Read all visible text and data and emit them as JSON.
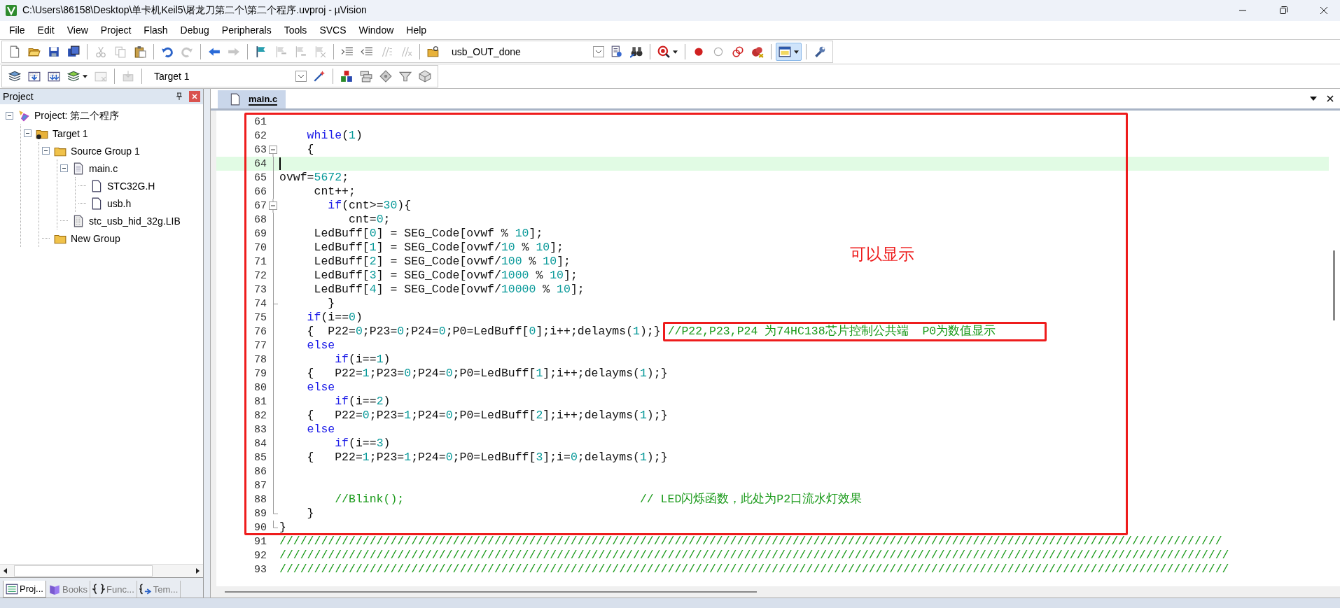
{
  "window": {
    "title": "C:\\Users\\86158\\Desktop\\单卡机Keil5\\屠龙刀第二个\\第二个程序.uvproj - µVision"
  },
  "menu": [
    "File",
    "Edit",
    "View",
    "Project",
    "Flash",
    "Debug",
    "Peripherals",
    "Tools",
    "SVCS",
    "Window",
    "Help"
  ],
  "toolbar_1": [
    {
      "kind": "new-file",
      "disabled": false,
      "pressed": false
    },
    {
      "kind": "open-folder",
      "disabled": false,
      "pressed": false
    },
    {
      "kind": "save",
      "disabled": false,
      "pressed": false
    },
    {
      "kind": "save-all",
      "disabled": false,
      "pressed": false
    },
    {
      "kind": "sep"
    },
    {
      "kind": "scissors",
      "disabled": true,
      "pressed": false
    },
    {
      "kind": "copy",
      "disabled": true,
      "pressed": false
    },
    {
      "kind": "paste",
      "disabled": false,
      "pressed": false
    },
    {
      "kind": "sep"
    },
    {
      "kind": "undo",
      "disabled": false,
      "pressed": false
    },
    {
      "kind": "redo",
      "disabled": true,
      "pressed": false
    },
    {
      "kind": "sep"
    },
    {
      "kind": "arrow-left",
      "disabled": false,
      "pressed": false
    },
    {
      "kind": "arrow-right",
      "disabled": true,
      "pressed": false
    },
    {
      "kind": "sep"
    },
    {
      "kind": "flag",
      "disabled": false,
      "pressed": false
    },
    {
      "kind": "flag-prev",
      "disabled": true,
      "pressed": false
    },
    {
      "kind": "flag-next",
      "disabled": true,
      "pressed": false
    },
    {
      "kind": "flag-clear",
      "disabled": true,
      "pressed": false
    },
    {
      "kind": "sep"
    },
    {
      "kind": "indent",
      "disabled": false,
      "pressed": false
    },
    {
      "kind": "unindent",
      "disabled": false,
      "pressed": false
    },
    {
      "kind": "comment",
      "disabled": true,
      "pressed": false
    },
    {
      "kind": "uncomment",
      "disabled": true,
      "pressed": false
    },
    {
      "kind": "sep"
    },
    {
      "kind": "folder-search",
      "disabled": false,
      "pressed": false
    },
    {
      "kind": "dropdown",
      "value": "usb_OUT_done"
    },
    {
      "kind": "document-search",
      "disabled": false,
      "pressed": false
    },
    {
      "kind": "binoculars",
      "disabled": false,
      "pressed": false
    },
    {
      "kind": "sep"
    },
    {
      "kind": "debug-magnifier",
      "disabled": false,
      "pressed": false,
      "menu": true
    },
    {
      "kind": "sep"
    },
    {
      "kind": "red-dot",
      "disabled": false,
      "pressed": false
    },
    {
      "kind": "empty-circle",
      "disabled": false,
      "pressed": false
    },
    {
      "kind": "red-rings",
      "disabled": false,
      "pressed": false
    },
    {
      "kind": "red-dot-cross",
      "disabled": false,
      "pressed": false
    },
    {
      "kind": "sep"
    },
    {
      "kind": "window-layout",
      "disabled": false,
      "pressed": true,
      "menu": true
    },
    {
      "kind": "sep"
    },
    {
      "kind": "wrench",
      "disabled": false,
      "pressed": false
    }
  ],
  "toolbar_2": [
    {
      "kind": "stack",
      "disabled": false,
      "pressed": false
    },
    {
      "kind": "build",
      "disabled": false,
      "pressed": false
    },
    {
      "kind": "rebuild",
      "disabled": false,
      "pressed": false
    },
    {
      "kind": "batch",
      "disabled": false,
      "pressed": false,
      "menu": true
    },
    {
      "kind": "stop",
      "disabled": true,
      "pressed": false
    },
    {
      "kind": "sep"
    },
    {
      "kind": "load",
      "disabled": true,
      "pressed": false
    },
    {
      "kind": "sep"
    },
    {
      "kind": "dropdown",
      "value": "Target 1"
    },
    {
      "kind": "magic-wand",
      "disabled": false,
      "pressed": false
    },
    {
      "kind": "sep"
    },
    {
      "kind": "blocks",
      "disabled": false,
      "pressed": false
    },
    {
      "kind": "layers",
      "disabled": false,
      "pressed": false
    },
    {
      "kind": "diamond",
      "disabled": false,
      "pressed": false
    },
    {
      "kind": "funnel",
      "disabled": false,
      "pressed": false
    },
    {
      "kind": "cube",
      "disabled": false,
      "pressed": false
    }
  ],
  "project_panel": {
    "title": "Project",
    "tree": [
      {
        "label": "Project: 第二个程序",
        "kind": "project",
        "expanded": true,
        "children": [
          {
            "label": "Target 1",
            "kind": "target",
            "expanded": true,
            "children": [
              {
                "label": "Source Group 1",
                "kind": "group",
                "expanded": true,
                "children": [
                  {
                    "label": "main.c",
                    "kind": "file",
                    "expanded": true,
                    "children": [
                      {
                        "label": "STC32G.H",
                        "kind": "header"
                      },
                      {
                        "label": "usb.h",
                        "kind": "header"
                      }
                    ]
                  },
                  {
                    "label": "stc_usb_hid_32g.LIB",
                    "kind": "library"
                  }
                ]
              },
              {
                "label": "New Group",
                "kind": "group"
              }
            ]
          }
        ]
      }
    ],
    "tabs": [
      {
        "label": "Proj...",
        "kind": "project",
        "selected": true
      },
      {
        "label": "Books",
        "kind": "books",
        "selected": false
      },
      {
        "label": "Func...",
        "kind": "functions",
        "selected": false
      },
      {
        "label": "Tem...",
        "kind": "templates",
        "selected": false
      }
    ]
  },
  "editor": {
    "tabs": [
      {
        "label": "main.c",
        "selected": true
      }
    ],
    "lines": [
      {
        "number": "61"
      },
      {
        "number": "62",
        "tokens": [
          {
            "kind": "keyword",
            "text": "    while"
          },
          {
            "kind": "text",
            "text": "("
          },
          {
            "kind": "number",
            "text": "1"
          },
          {
            "kind": "text",
            "text": ")"
          }
        ]
      },
      {
        "number": "63",
        "fold_start": true,
        "tokens": [
          {
            "kind": "text",
            "text": "    {"
          }
        ]
      },
      {
        "number": "64",
        "current": true
      },
      {
        "number": "65",
        "tokens": [
          {
            "kind": "text",
            "text": "ovwf="
          },
          {
            "kind": "number",
            "text": "5672"
          },
          {
            "kind": "text",
            "text": ";"
          }
        ]
      },
      {
        "number": "66",
        "tokens": [
          {
            "kind": "text",
            "text": "     cnt++;"
          }
        ]
      },
      {
        "number": "67",
        "fold_start": true,
        "tokens": [
          {
            "kind": "keyword",
            "text": "       if"
          },
          {
            "kind": "text",
            "text": "(cnt>="
          },
          {
            "kind": "number",
            "text": "30"
          },
          {
            "kind": "text",
            "text": "){"
          }
        ]
      },
      {
        "number": "68",
        "tokens": [
          {
            "kind": "text",
            "text": "          cnt="
          },
          {
            "kind": "number",
            "text": "0"
          },
          {
            "kind": "text",
            "text": ";"
          }
        ]
      },
      {
        "number": "69",
        "tokens": [
          {
            "kind": "text",
            "text": "     LedBuff["
          },
          {
            "kind": "number",
            "text": "0"
          },
          {
            "kind": "text",
            "text": "] = SEG_Code[ovwf % "
          },
          {
            "kind": "number",
            "text": "10"
          },
          {
            "kind": "text",
            "text": "];"
          }
        ]
      },
      {
        "number": "70",
        "tokens": [
          {
            "kind": "text",
            "text": "     LedBuff["
          },
          {
            "kind": "number",
            "text": "1"
          },
          {
            "kind": "text",
            "text": "] = SEG_Code[ovwf/"
          },
          {
            "kind": "number",
            "text": "10"
          },
          {
            "kind": "text",
            "text": " % "
          },
          {
            "kind": "number",
            "text": "10"
          },
          {
            "kind": "text",
            "text": "];"
          }
        ]
      },
      {
        "number": "71",
        "tokens": [
          {
            "kind": "text",
            "text": "     LedBuff["
          },
          {
            "kind": "number",
            "text": "2"
          },
          {
            "kind": "text",
            "text": "] = SEG_Code[ovwf/"
          },
          {
            "kind": "number",
            "text": "100"
          },
          {
            "kind": "text",
            "text": " % "
          },
          {
            "kind": "number",
            "text": "10"
          },
          {
            "kind": "text",
            "text": "];"
          }
        ]
      },
      {
        "number": "72",
        "tokens": [
          {
            "kind": "text",
            "text": "     LedBuff["
          },
          {
            "kind": "number",
            "text": "3"
          },
          {
            "kind": "text",
            "text": "] = SEG_Code[ovwf/"
          },
          {
            "kind": "number",
            "text": "1000"
          },
          {
            "kind": "text",
            "text": " % "
          },
          {
            "kind": "number",
            "text": "10"
          },
          {
            "kind": "text",
            "text": "];"
          }
        ]
      },
      {
        "number": "73",
        "tokens": [
          {
            "kind": "text",
            "text": "     LedBuff["
          },
          {
            "kind": "number",
            "text": "4"
          },
          {
            "kind": "text",
            "text": "] = SEG_Code[ovwf/"
          },
          {
            "kind": "number",
            "text": "10000"
          },
          {
            "kind": "text",
            "text": " % "
          },
          {
            "kind": "number",
            "text": "10"
          },
          {
            "kind": "text",
            "text": "];"
          }
        ]
      },
      {
        "number": "74",
        "fold_end": true,
        "tokens": [
          {
            "kind": "text",
            "text": "       }"
          }
        ]
      },
      {
        "number": "75",
        "tokens": [
          {
            "kind": "keyword",
            "text": "    if"
          },
          {
            "kind": "text",
            "text": "(i=="
          },
          {
            "kind": "number",
            "text": "0"
          },
          {
            "kind": "text",
            "text": ")"
          }
        ]
      },
      {
        "number": "76",
        "boxed": true,
        "tokens": [
          {
            "kind": "text",
            "text": "    {  P22="
          },
          {
            "kind": "number",
            "text": "0"
          },
          {
            "kind": "text",
            "text": ";P23="
          },
          {
            "kind": "number",
            "text": "0"
          },
          {
            "kind": "text",
            "text": ";P24="
          },
          {
            "kind": "number",
            "text": "0"
          },
          {
            "kind": "text",
            "text": ";P0=LedBuff["
          },
          {
            "kind": "number",
            "text": "0"
          },
          {
            "kind": "text",
            "text": "];i++;delayms("
          },
          {
            "kind": "number",
            "text": "1"
          },
          {
            "kind": "text",
            "text": ");}"
          },
          {
            "kind": "comment",
            "text": "//P22,P23,P24 为74HC138芯片控制公共端  P0为数值显示"
          }
        ]
      },
      {
        "number": "77",
        "tokens": [
          {
            "kind": "keyword",
            "text": "    else"
          }
        ]
      },
      {
        "number": "78",
        "tokens": [
          {
            "kind": "keyword",
            "text": "        if"
          },
          {
            "kind": "text",
            "text": "(i=="
          },
          {
            "kind": "number",
            "text": "1"
          },
          {
            "kind": "text",
            "text": ")"
          }
        ]
      },
      {
        "number": "79",
        "tokens": [
          {
            "kind": "text",
            "text": "    {   P22="
          },
          {
            "kind": "number",
            "text": "1"
          },
          {
            "kind": "text",
            "text": ";P23="
          },
          {
            "kind": "number",
            "text": "0"
          },
          {
            "kind": "text",
            "text": ";P24="
          },
          {
            "kind": "number",
            "text": "0"
          },
          {
            "kind": "text",
            "text": ";P0=LedBuff["
          },
          {
            "kind": "number",
            "text": "1"
          },
          {
            "kind": "text",
            "text": "];i++;delayms("
          },
          {
            "kind": "number",
            "text": "1"
          },
          {
            "kind": "text",
            "text": ");}"
          }
        ]
      },
      {
        "number": "80",
        "tokens": [
          {
            "kind": "keyword",
            "text": "    else"
          }
        ]
      },
      {
        "number": "81",
        "tokens": [
          {
            "kind": "keyword",
            "text": "        if"
          },
          {
            "kind": "text",
            "text": "(i=="
          },
          {
            "kind": "number",
            "text": "2"
          },
          {
            "kind": "text",
            "text": ")"
          }
        ]
      },
      {
        "number": "82",
        "tokens": [
          {
            "kind": "text",
            "text": "    {   P22="
          },
          {
            "kind": "number",
            "text": "0"
          },
          {
            "kind": "text",
            "text": ";P23="
          },
          {
            "kind": "number",
            "text": "1"
          },
          {
            "kind": "text",
            "text": ";P24="
          },
          {
            "kind": "number",
            "text": "0"
          },
          {
            "kind": "text",
            "text": ";P0=LedBuff["
          },
          {
            "kind": "number",
            "text": "2"
          },
          {
            "kind": "text",
            "text": "];i++;delayms("
          },
          {
            "kind": "number",
            "text": "1"
          },
          {
            "kind": "text",
            "text": ");}"
          }
        ]
      },
      {
        "number": "83",
        "tokens": [
          {
            "kind": "keyword",
            "text": "    else"
          }
        ]
      },
      {
        "number": "84",
        "tokens": [
          {
            "kind": "keyword",
            "text": "        if"
          },
          {
            "kind": "text",
            "text": "(i=="
          },
          {
            "kind": "number",
            "text": "3"
          },
          {
            "kind": "text",
            "text": ")"
          }
        ]
      },
      {
        "number": "85",
        "tokens": [
          {
            "kind": "text",
            "text": "    {   P22="
          },
          {
            "kind": "number",
            "text": "1"
          },
          {
            "kind": "text",
            "text": ";P23="
          },
          {
            "kind": "number",
            "text": "1"
          },
          {
            "kind": "text",
            "text": ";P24="
          },
          {
            "kind": "number",
            "text": "0"
          },
          {
            "kind": "text",
            "text": ";P0=LedBuff["
          },
          {
            "kind": "number",
            "text": "3"
          },
          {
            "kind": "text",
            "text": "];i="
          },
          {
            "kind": "number",
            "text": "0"
          },
          {
            "kind": "text",
            "text": ";delayms("
          },
          {
            "kind": "number",
            "text": "1"
          },
          {
            "kind": "text",
            "text": ");}"
          }
        ]
      },
      {
        "number": "86"
      },
      {
        "number": "87"
      },
      {
        "number": "88",
        "tokens": [
          {
            "kind": "comment",
            "text": "        //Blink();                                  // LED闪烁函数，此处为P2口流水灯效果"
          }
        ]
      },
      {
        "number": "89",
        "fold_end": true,
        "tokens": [
          {
            "kind": "text",
            "text": "    }"
          }
        ]
      },
      {
        "number": "90",
        "fold_end": true,
        "tokens": [
          {
            "kind": "text",
            "text": "}"
          }
        ]
      },
      {
        "number": "91",
        "tokens": [
          {
            "kind": "comment",
            "text": "////////////////////////////////////////////////////////////////////////////////////////////////////////////////////////////////////////"
          }
        ]
      },
      {
        "number": "92",
        "tokens": [
          {
            "kind": "comment",
            "text": "/////////////////////////////////////////////////////////////////////////////////////////////////////////////////////////////////////////"
          }
        ]
      },
      {
        "number": "93",
        "tokens": [
          {
            "kind": "comment",
            "text": "/////////////////////////////////////////////////////////////////////////////////////////////////////////////////////////////////////////"
          }
        ]
      }
    ],
    "annotation": "可以显示"
  }
}
